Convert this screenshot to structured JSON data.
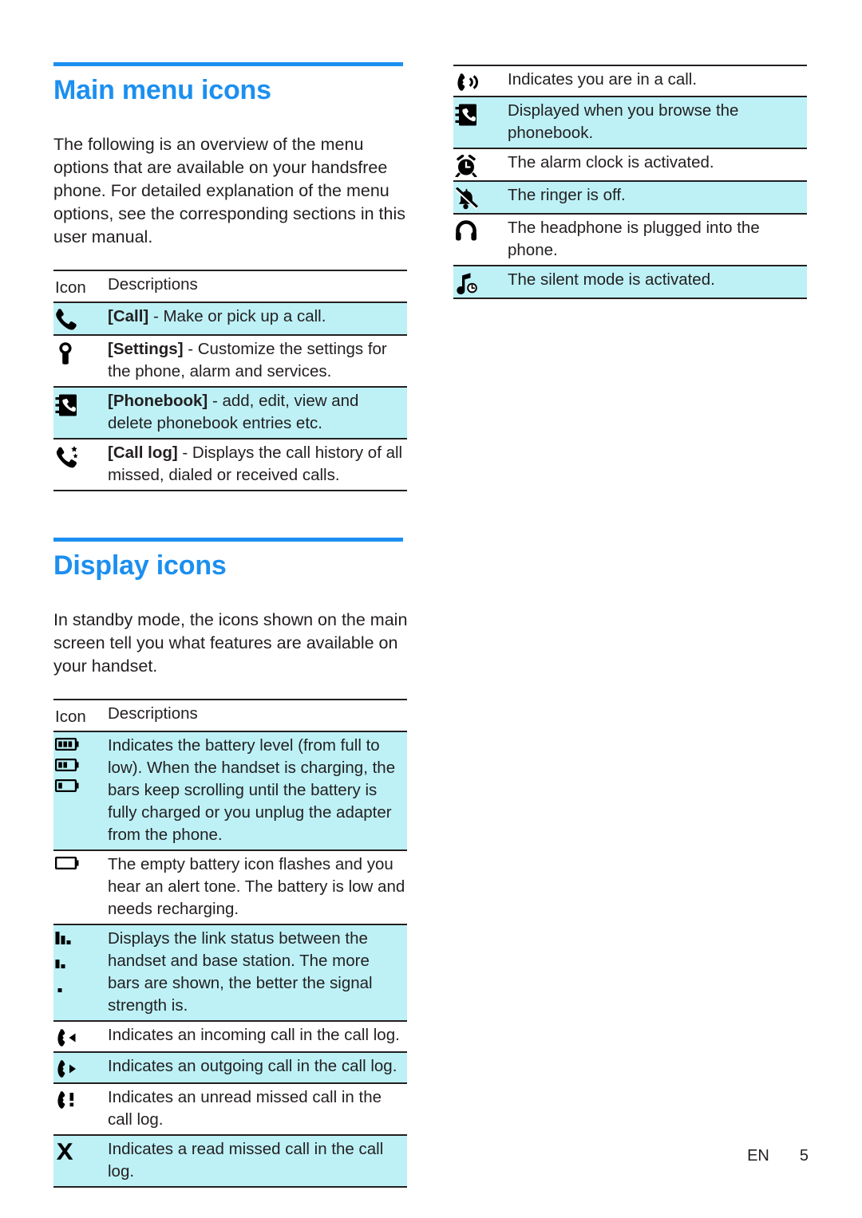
{
  "sections": {
    "main_menu": {
      "title": "Main menu icons",
      "intro": "The following is an overview of the menu options that are available on your handsfree phone. For detailed explanation of the menu options, see the corresponding sections in this user manual.",
      "table": {
        "header": {
          "icon": "Icon",
          "description": "Descriptions"
        },
        "rows": [
          {
            "icon": "phone-handset-icon",
            "label": "[Call]",
            "text": " - Make or pick up a call.",
            "highlight": true
          },
          {
            "icon": "wrench-icon",
            "label": "[Settings]",
            "text": " - Customize the settings for the phone, alarm and services.",
            "highlight": false
          },
          {
            "icon": "phonebook-icon",
            "label": "[Phonebook]",
            "text": " - add, edit, view and delete phonebook entries etc.",
            "highlight": true
          },
          {
            "icon": "call-log-icon",
            "label": "[Call log]",
            "text": " - Displays the call history of all missed, dialed or received calls.",
            "highlight": false
          }
        ]
      }
    },
    "display_icons": {
      "title": "Display icons",
      "intro": "In standby mode, the icons shown on the main screen tell you what features are available on your handset.",
      "table": {
        "header": {
          "icon": "Icon",
          "description": "Descriptions"
        },
        "rows": [
          {
            "icon": "battery-level-icons",
            "text": "Indicates the battery level (from full to low). When the handset is charging, the bars keep scrolling until the battery is fully charged or you unplug the adapter from the phone.",
            "highlight": true
          },
          {
            "icon": "battery-empty-icon",
            "text": "The empty battery icon flashes and you hear an alert tone. The battery is low and needs recharging.",
            "highlight": false
          },
          {
            "icon": "signal-strength-icons",
            "text": "Displays the link status between the handset and base station. The more bars are shown, the better the signal strength is.",
            "highlight": true
          },
          {
            "icon": "incoming-call-icon",
            "text": "Indicates an incoming call in the call log.",
            "highlight": false
          },
          {
            "icon": "outgoing-call-icon",
            "text": "Indicates an outgoing call in the call log.",
            "highlight": true
          },
          {
            "icon": "unread-missed-call-icon",
            "text": "Indicates an unread missed call in the call log.",
            "highlight": false
          },
          {
            "icon": "read-missed-call-icon",
            "text": "Indicates a read missed call in the call log.",
            "highlight": true
          }
        ]
      }
    },
    "status_icons": {
      "table": {
        "rows": [
          {
            "icon": "in-call-icon",
            "text": "Indicates you are in a call.",
            "highlight": false
          },
          {
            "icon": "phonebook-browse-icon",
            "text": "Displayed when you browse the phonebook.",
            "highlight": true
          },
          {
            "icon": "alarm-clock-icon",
            "text": "The alarm clock is activated.",
            "highlight": false
          },
          {
            "icon": "ringer-off-icon",
            "text": "The ringer is off.",
            "highlight": true
          },
          {
            "icon": "headphone-icon",
            "text": "The headphone is plugged into the phone.",
            "highlight": false
          },
          {
            "icon": "silent-mode-icon",
            "text": "The silent mode is activated.",
            "highlight": true
          }
        ]
      }
    }
  },
  "footer": {
    "language": "EN",
    "page_number": "5"
  },
  "colors": {
    "accent": "#1c8ff0",
    "highlight": "#bdf1f6",
    "text": "#231f20"
  }
}
